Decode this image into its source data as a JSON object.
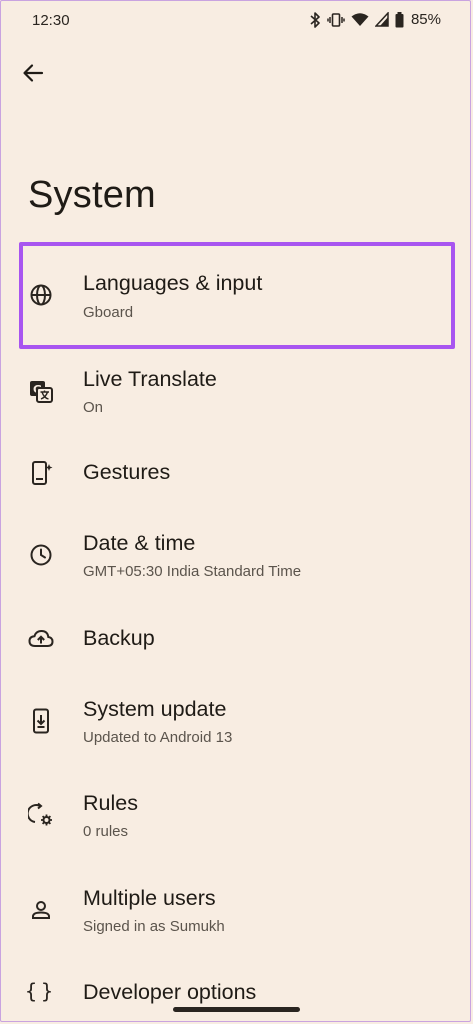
{
  "status_bar": {
    "time": "12:30",
    "battery_percent": "85%",
    "icons": [
      "bluetooth-icon",
      "vibrate-icon",
      "wifi-icon",
      "cellular-signal-icon",
      "battery-icon"
    ]
  },
  "header": {
    "back_icon": "arrow-back-icon",
    "title": "System"
  },
  "items": [
    {
      "icon": "globe-icon",
      "title": "Languages & input",
      "subtitle": "Gboard"
    },
    {
      "icon": "translate-icon",
      "title": "Live Translate",
      "subtitle": "On"
    },
    {
      "icon": "gestures-phone-icon",
      "title": "Gestures",
      "subtitle": ""
    },
    {
      "icon": "clock-icon",
      "title": "Date & time",
      "subtitle": "GMT+05:30 India Standard Time"
    },
    {
      "icon": "cloud-upload-icon",
      "title": "Backup",
      "subtitle": ""
    },
    {
      "icon": "system-update-icon",
      "title": "System update",
      "subtitle": "Updated to Android 13"
    },
    {
      "icon": "rules-icon",
      "title": "Rules",
      "subtitle": "0 rules"
    },
    {
      "icon": "person-icon",
      "title": "Multiple users",
      "subtitle": "Signed in as Sumukh"
    },
    {
      "icon": "braces-icon",
      "title": "Developer options",
      "subtitle": ""
    }
  ],
  "colors": {
    "background": "#f8ede2",
    "highlight": "#a855f0",
    "text_primary": "#1f1b16",
    "text_secondary": "#5b544c"
  }
}
